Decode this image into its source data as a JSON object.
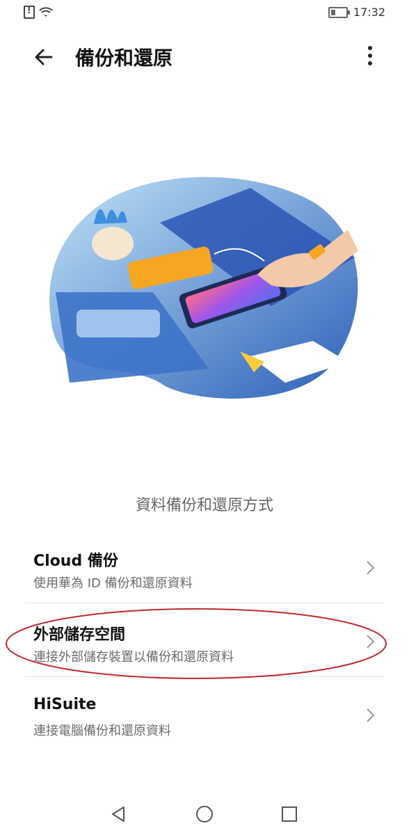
{
  "status_bar": {
    "time": "17:32"
  },
  "header": {
    "title": "備份和還原"
  },
  "section_title": "資料備份和還原方式",
  "items": [
    {
      "title": "Cloud 備份",
      "subtitle": "使用華為 ID 備份和還原資料"
    },
    {
      "title": "外部儲存空間",
      "subtitle": "連接外部儲存裝置以備份和還原資料"
    },
    {
      "title": "HiSuite",
      "subtitle": "連接電腦備份和還原資料"
    }
  ],
  "icons": [
    "sim-alert-icon",
    "wifi-icon",
    "battery-icon",
    "back-arrow-icon",
    "more-vert-icon",
    "chevron-right-icon",
    "nav-back-icon",
    "nav-home-icon",
    "nav-recents-icon"
  ],
  "colors": {
    "highlight": "#c0282d",
    "text_secondary": "#6b6b6b"
  }
}
